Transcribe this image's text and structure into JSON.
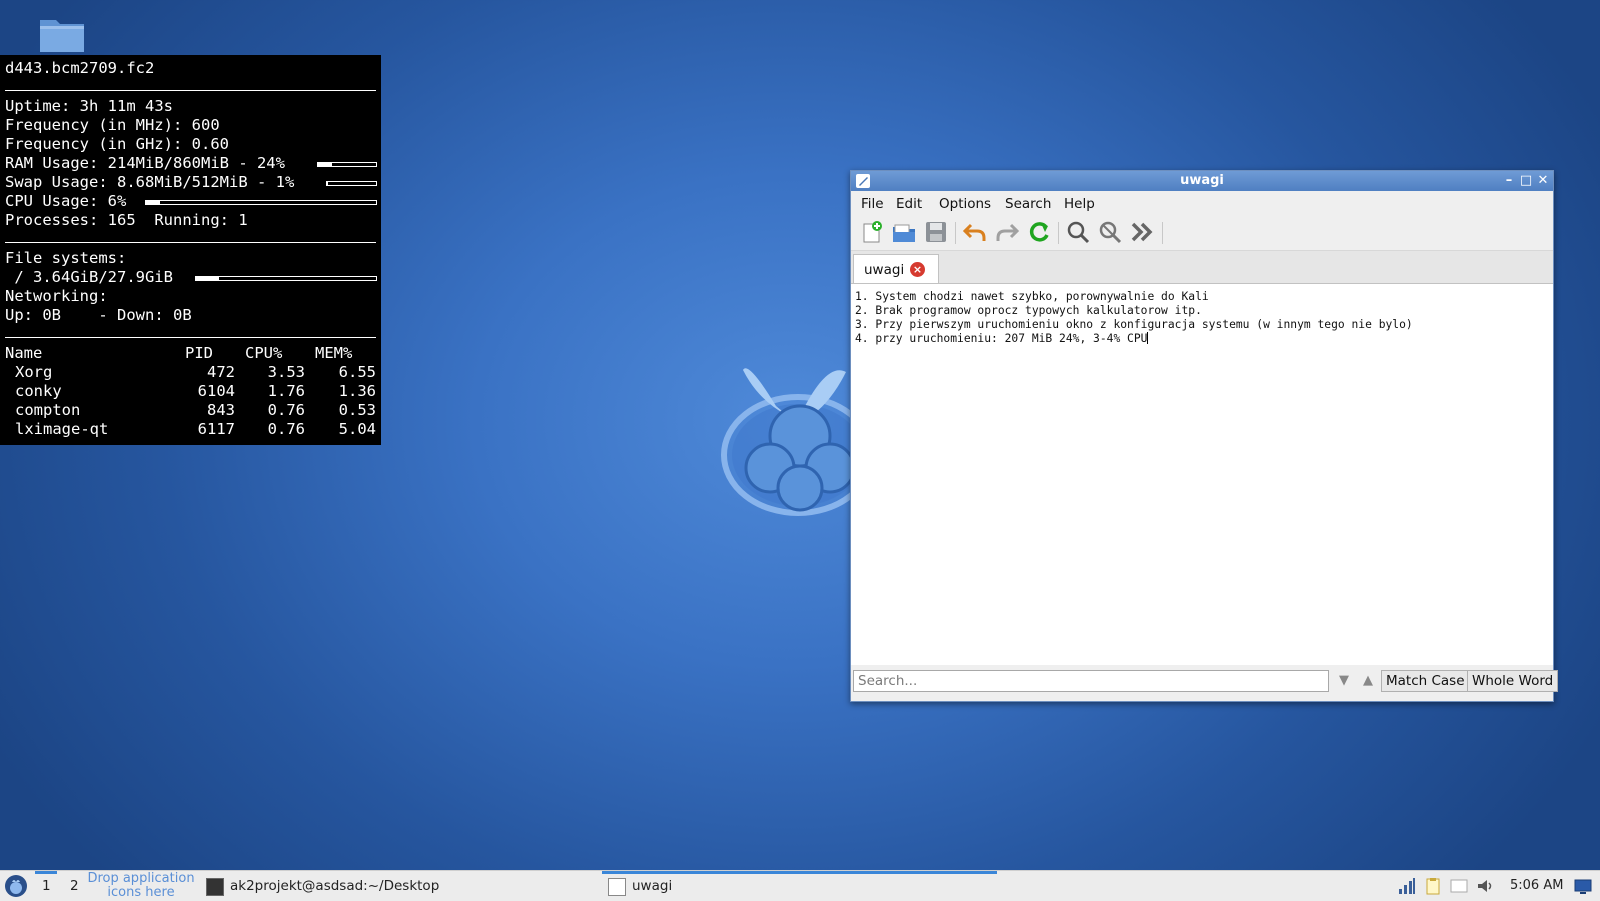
{
  "desktop": {
    "folder_icon": "folder-icon"
  },
  "conky": {
    "host": "d443.bcm2709.fc2",
    "uptime_label": "Uptime:",
    "uptime_value": "3h 11m 43s",
    "freq_mhz_label": "Frequency (in MHz):",
    "freq_mhz_value": "600",
    "freq_ghz_label": "Frequency (in GHz):",
    "freq_ghz_value": "0.60",
    "ram_label": "RAM Usage:",
    "ram_value": "214MiB/860MiB - 24%",
    "ram_percent": 24,
    "swap_label": "Swap Usage:",
    "swap_value": "8.68MiB/512MiB - 1%",
    "swap_percent": 1,
    "cpu_label": "CPU Usage:",
    "cpu_value": "6%",
    "cpu_percent": 6,
    "processes_label": "Processes:",
    "processes_value": "165",
    "running_label": "Running:",
    "running_value": "1",
    "fs_label": "File systems:",
    "fs_root_value": " / 3.64GiB/27.9GiB",
    "fs_root_percent": 13,
    "net_label": "Networking:",
    "up_label": "Up:",
    "up_value": "0B",
    "down_label": "- Down:",
    "down_value": "0B",
    "table_headers": [
      "Name",
      "PID",
      "CPU%",
      "MEM%"
    ],
    "processes": [
      {
        "name": "Xorg",
        "pid": "472",
        "cpu": "3.53",
        "mem": "6.55"
      },
      {
        "name": "conky",
        "pid": "6104",
        "cpu": "1.76",
        "mem": "1.36"
      },
      {
        "name": "compton",
        "pid": "843",
        "cpu": "0.76",
        "mem": "0.53"
      },
      {
        "name": "lximage-qt",
        "pid": "6117",
        "cpu": "0.76",
        "mem": "5.04"
      }
    ]
  },
  "window": {
    "title": "uwagi",
    "menu": [
      "File",
      "Edit",
      "Options",
      "Search",
      "Help"
    ],
    "toolbar_icons": [
      "new-file-icon",
      "open-file-icon",
      "save-icon",
      "undo-icon",
      "redo-icon",
      "reload-icon",
      "find-icon",
      "clear-find-icon",
      "jump-icon"
    ],
    "tab_label": "uwagi",
    "lines": [
      "1. System chodzi nawet szybko, porownywalnie do Kali",
      "2. Brak programow oprocz typowych kalkulatorow itp.",
      "3. Przy pierwszym uruchomieniu okno z konfiguracja systemu (w innym tego nie bylo)",
      "4. przy uruchomieniu: 207 MiB 24%, 3-4% CPU"
    ],
    "search_placeholder": "Search...",
    "match_case": "Match Case",
    "whole_word": "Whole Word"
  },
  "taskbar": {
    "workspaces": [
      "1",
      "2"
    ],
    "drop_hint_line1": "Drop application",
    "drop_hint_line2": "icons here",
    "tasks": [
      {
        "label": "ak2projekt@asdsad:~/Desktop",
        "icon": "terminal-icon"
      },
      {
        "label": "uwagi",
        "icon": "text-editor-icon"
      }
    ],
    "tray_icons": [
      "network-icon",
      "clipboard-icon",
      "battery-icon",
      "volume-icon"
    ],
    "clock": "5:06 AM",
    "show_desktop_icon": "show-desktop-icon",
    "accent": "#3a86d8"
  }
}
